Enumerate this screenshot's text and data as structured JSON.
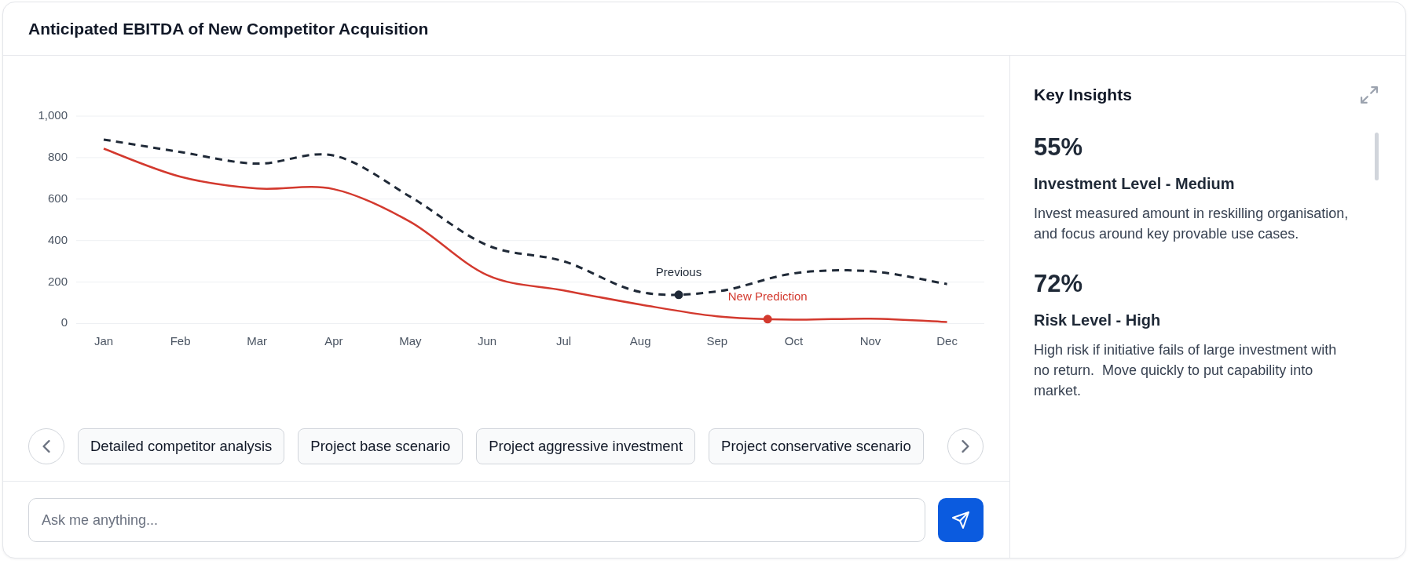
{
  "header": {
    "title": "Anticipated EBITDA of New Competitor Acquisition"
  },
  "chart": {
    "chart_data": {
      "type": "line",
      "grid": true,
      "categories": [
        "Jan",
        "Feb",
        "Mar",
        "Apr",
        "May",
        "Jun",
        "Jul",
        "Aug",
        "Sep",
        "Oct",
        "Nov",
        "Dec"
      ],
      "ylim": [
        0,
        1000
      ],
      "yticks": [
        0,
        200,
        400,
        600,
        800,
        {
          "value": 1000,
          "label": "1,000"
        }
      ],
      "series": [
        {
          "color": "#1f2937",
          "line_style": "dashed",
          "values": [
            887,
            827,
            771,
            810,
            611,
            378,
            300,
            152,
            155,
            242,
            252,
            190
          ]
        },
        {
          "color": "#d3392e",
          "values": [
            843,
            708,
            651,
            648,
            490,
            234,
            160,
            92,
            35,
            19,
            24,
            8
          ]
        }
      ],
      "annotations": [
        "Previous",
        "New Prediction"
      ]
    }
  },
  "suggestions": {
    "items": [
      {
        "label": "Detailed competitor analysis"
      },
      {
        "label": "Project base scenario"
      },
      {
        "label": "Project aggressive investment"
      },
      {
        "label": "Project conservative scenario"
      }
    ]
  },
  "chat": {
    "placeholder": "Ask me anything..."
  },
  "insights": {
    "title": "Key Insights",
    "items": [
      {
        "value": "55%",
        "heading": "Investment Level - Medium",
        "description": "Invest measured amount in reskilling organisation, and focus around key provable use cases."
      },
      {
        "value": "72%",
        "heading": "Risk Level - High",
        "description": "High risk if initiative fails of large investment with no return.  Move quickly to put capability into market."
      }
    ]
  }
}
